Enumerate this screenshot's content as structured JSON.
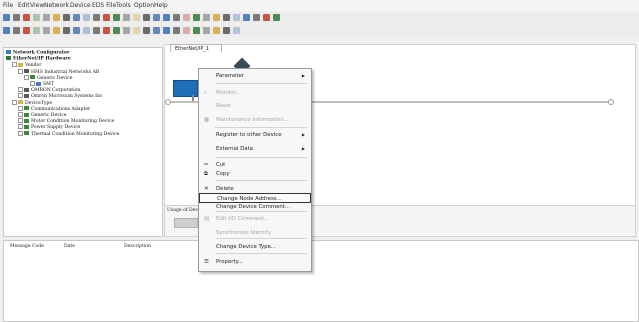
{
  "menu": [
    "File",
    "Edit",
    "View",
    "Network",
    "Device",
    "EDS File",
    "Tools",
    "Option",
    "Help"
  ],
  "tab_label": "EtherNet/IP_1",
  "tree": [
    {
      "label": "Network Configurator",
      "depth": 0,
      "icon": "network-configurator-icon",
      "color": "#3a7ac0"
    },
    {
      "label": "EtherNet/IP Hardware",
      "depth": 0,
      "icon": "ethernet-hardware-icon",
      "color": "#2f7a3a"
    },
    {
      "label": "Vendor",
      "depth": 1,
      "icon": "folder-icon",
      "color": "#d8b24a"
    },
    {
      "label": "HMS Industrial Networks AB",
      "depth": 2,
      "icon": "vendor-icon",
      "color": "#5a5a5a"
    },
    {
      "label": "Generic Device",
      "depth": 3,
      "icon": "device-icon",
      "color": "#3a8a3a"
    },
    {
      "label": "SMT",
      "depth": 4,
      "icon": "module-icon",
      "color": "#4a78b8"
    },
    {
      "label": "OMRON Corporation",
      "depth": 2,
      "icon": "vendor-icon",
      "color": "#5a5a5a"
    },
    {
      "label": "Omron Microscan Systems Inc",
      "depth": 2,
      "icon": "vendor-icon",
      "color": "#5a5a5a"
    },
    {
      "label": "DeviceType",
      "depth": 1,
      "icon": "folder-icon",
      "color": "#d8b24a"
    },
    {
      "label": "Communications Adapter",
      "depth": 2,
      "icon": "device-icon",
      "color": "#3a8a3a"
    },
    {
      "label": "Generic Device",
      "depth": 2,
      "icon": "device-icon",
      "color": "#3a8a3a"
    },
    {
      "label": "Motor Condition Monitoring Device",
      "depth": 2,
      "icon": "device-icon",
      "color": "#3a8a3a"
    },
    {
      "label": "Power Supply Device",
      "depth": 2,
      "icon": "device-icon",
      "color": "#3a8a3a"
    },
    {
      "label": "Thermal Condition Monitoring Device",
      "depth": 2,
      "icon": "device-icon",
      "color": "#3a8a3a"
    }
  ],
  "usage_label": "Usage of Dev",
  "message_columns": [
    "Message Code",
    "Date",
    "Description"
  ],
  "context_menu": [
    {
      "label": "Parameter",
      "submenu": true,
      "disabled": false,
      "highlight": false
    },
    {
      "label": "Monitor...",
      "submenu": false,
      "disabled": true,
      "highlight": false,
      "glyph": "⌕"
    },
    {
      "label": "Reset",
      "submenu": false,
      "disabled": true,
      "highlight": false
    },
    {
      "label": "Maintenance Information...",
      "submenu": false,
      "disabled": true,
      "highlight": false,
      "glyph": "▦"
    },
    {
      "label": "Register to other Device",
      "submenu": true,
      "disabled": false,
      "highlight": false
    },
    {
      "label": "External Data",
      "submenu": true,
      "disabled": false,
      "highlight": false
    },
    {
      "label": "Cut",
      "submenu": false,
      "disabled": false,
      "highlight": false,
      "glyph": "✂"
    },
    {
      "label": "Copy",
      "submenu": false,
      "disabled": false,
      "highlight": false,
      "glyph": "⧉"
    },
    {
      "label": "Delete",
      "submenu": false,
      "disabled": false,
      "highlight": false,
      "glyph": "✕"
    },
    {
      "label": "Change Node Address...",
      "submenu": false,
      "disabled": false,
      "highlight": true
    },
    {
      "label": "Change Device Comment...",
      "submenu": false,
      "disabled": false,
      "highlight": false
    },
    {
      "label": "Edit I/O Comment...",
      "submenu": false,
      "disabled": true,
      "highlight": false,
      "glyph": "▤"
    },
    {
      "label": "Synchronize Identity",
      "submenu": false,
      "disabled": true,
      "highlight": false
    },
    {
      "label": "Change Device Type...",
      "submenu": false,
      "disabled": false,
      "highlight": false
    },
    {
      "label": "Property...",
      "submenu": false,
      "disabled": false,
      "highlight": false,
      "glyph": "☰"
    }
  ],
  "colors": {
    "accent": "#3a7ac0",
    "highlight_border": "#333333",
    "disabled_text": "#a6a6a6",
    "device_blue": "#1f6fb8"
  }
}
